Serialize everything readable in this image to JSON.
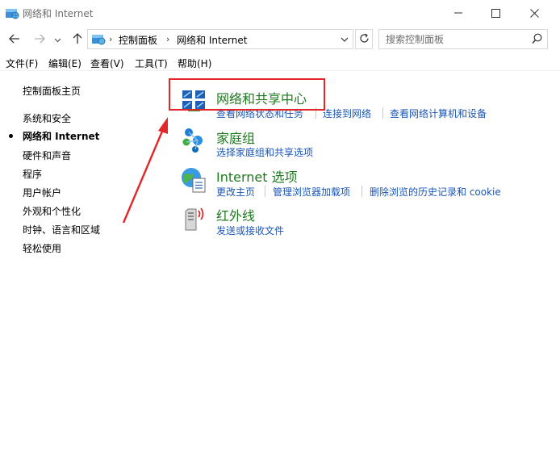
{
  "window": {
    "title": "网络和 Internet"
  },
  "address": {
    "breadcrumbs": [
      "控制面板",
      "网络和 Internet"
    ]
  },
  "search": {
    "placeholder": "搜索控制面板"
  },
  "menubar": {
    "items": [
      "文件(F)",
      "编辑(E)",
      "查看(V)",
      "工具(T)",
      "帮助(H)"
    ]
  },
  "sidebar": {
    "items": [
      {
        "label": "控制面板主页",
        "active": false
      },
      {
        "label": "系统和安全",
        "active": false
      },
      {
        "label": "网络和 Internet",
        "active": true
      },
      {
        "label": "硬件和声音",
        "active": false
      },
      {
        "label": "程序",
        "active": false
      },
      {
        "label": "用户帐户",
        "active": false
      },
      {
        "label": "外观和个性化",
        "active": false
      },
      {
        "label": "时钟、语言和区域",
        "active": false
      },
      {
        "label": "轻松使用",
        "active": false
      }
    ]
  },
  "categories": [
    {
      "icon": "network-sharing-center-icon",
      "title": "网络和共享中心",
      "links": [
        "查看网络状态和任务",
        "连接到网络",
        "查看网络计算机和设备"
      ]
    },
    {
      "icon": "homegroup-icon",
      "title": "家庭组",
      "links": [
        "选择家庭组和共享选项"
      ]
    },
    {
      "icon": "internet-options-icon",
      "title": "Internet 选项",
      "links": [
        "更改主页",
        "管理浏览器加载项",
        "删除浏览的历史记录和 cookie"
      ]
    },
    {
      "icon": "infrared-icon",
      "title": "红外线",
      "links": [
        "发送或接收文件"
      ]
    }
  ],
  "colors": {
    "category_title": "#1e7a1e",
    "link": "#1a56b8",
    "annotation": "#e2262a"
  }
}
